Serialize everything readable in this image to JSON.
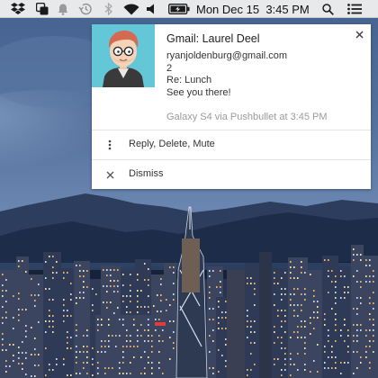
{
  "menubar": {
    "icons": [
      "dropbox-icon",
      "pushbullet-icon",
      "notification-bell-icon",
      "time-machine-icon",
      "bluetooth-icon",
      "wifi-icon",
      "volume-icon",
      "battery-icon",
      "spotlight-search-icon",
      "notification-center-icon"
    ],
    "clock": "Mon Dec 15  3:45 PM"
  },
  "notification": {
    "title": "Gmail: Laurel Deel",
    "lines": [
      "ryanjoldenburg@gmail.com",
      "2",
      "Re: Lunch",
      "See you there!"
    ],
    "footer": "Galaxy S4 via Pushbullet at 3:45 PM",
    "close_icon": "close-icon",
    "actions": [
      {
        "icon": "more-vertical-icon",
        "label": "Reply, Delete, Mute"
      },
      {
        "icon": "close-icon",
        "label": "Dismiss"
      }
    ]
  },
  "colors": {
    "menubar_bg": "#eeeeee",
    "avatar_bg": "#63c7d8",
    "notification_bg": "#ffffff",
    "footer_text": "#9a9a9a"
  }
}
